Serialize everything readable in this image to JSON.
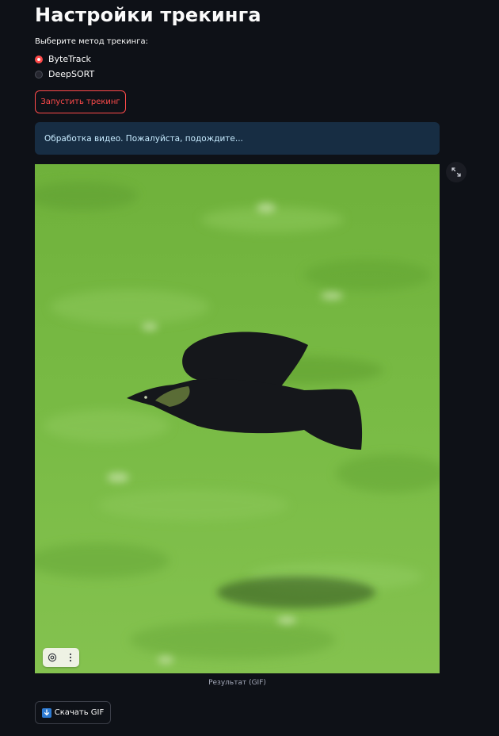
{
  "page": {
    "title": "Настройки трекинга"
  },
  "tracking": {
    "method_label": "Выберите метод трекинга:",
    "options": [
      {
        "label": "ByteTrack",
        "selected": true
      },
      {
        "label": "DeepSORT",
        "selected": false
      }
    ]
  },
  "actions": {
    "run_label": "Запустить трекинг",
    "download_label": "Скачать GIF",
    "download_icon": "download-arrow-icon"
  },
  "status": {
    "info_text": "Обработка видео. Пожалуйста, подождите..."
  },
  "media": {
    "caption": "Результат (GIF)",
    "toolbar_icons": [
      "view-icon",
      "more-options-icon"
    ],
    "fullscreen_icon": "expand-icon"
  },
  "colors": {
    "background": "#0e1117",
    "accent": "#ff4b4b",
    "info_background": "#172d43",
    "info_text": "#c7ebff"
  }
}
